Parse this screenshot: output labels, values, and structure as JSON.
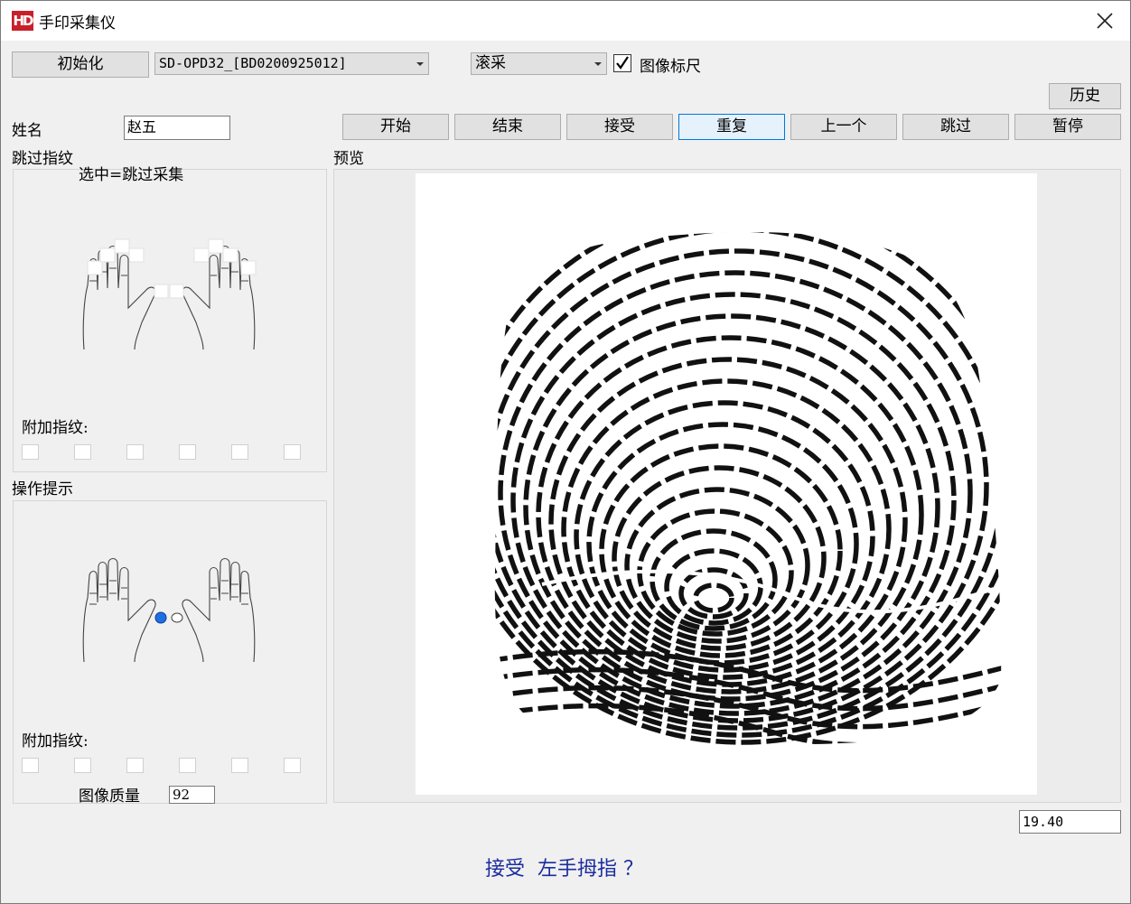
{
  "window": {
    "title": "手印采集仪",
    "logo_text": "HD"
  },
  "toolbar": {
    "init_label": "初始化",
    "device_value": "SD-OPD32_[BD0200925012]",
    "mode_value": "滚采",
    "ruler_label": "图像标尺",
    "ruler_checked": true,
    "history_label": "历史"
  },
  "form": {
    "name_label": "姓名",
    "name_value": "赵五"
  },
  "actions": {
    "start": "开始",
    "end": "结束",
    "accept": "接受",
    "repeat": "重复",
    "prev": "上一个",
    "skip": "跳过",
    "pause": "暂停"
  },
  "skip_panel": {
    "title": "跳过指纹",
    "hint": "选中=跳过采集",
    "extra_label": "附加指纹:"
  },
  "tips_panel": {
    "title": "操作提示",
    "extra_label": "附加指纹:",
    "quality_label": "图像质量",
    "quality_value": "92"
  },
  "preview": {
    "title": "预览",
    "ruler_value": "19.40"
  },
  "status_message": "接受  左手拇指 ？",
  "colors": {
    "accent": "#0078d7",
    "message": "#1c2d9e",
    "logo": "#c8202a"
  }
}
